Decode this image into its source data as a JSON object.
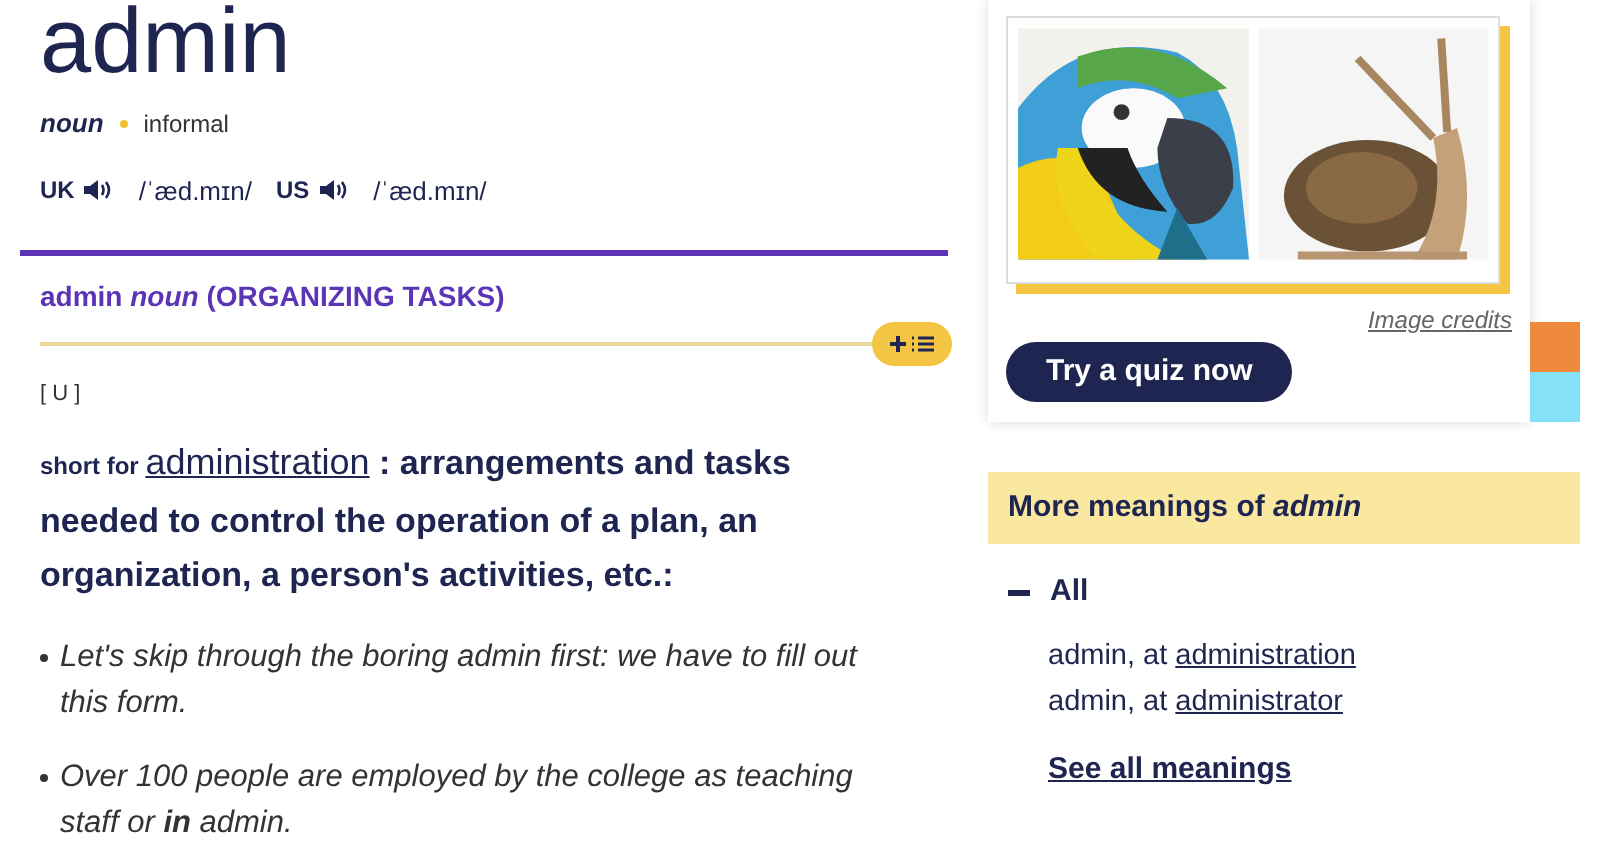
{
  "headword": "admin",
  "pos": {
    "label": "noun",
    "register": "informal"
  },
  "pronunciations": [
    {
      "region": "UK",
      "ipa": "/ˈæd.mɪn/"
    },
    {
      "region": "US",
      "ipa": "/ˈæd.mɪn/"
    }
  ],
  "sense": {
    "word": "admin",
    "pos": "noun",
    "guide": "(ORGANIZING TASKS)",
    "grammar": "[ U ]",
    "definition": {
      "prefix": "short for",
      "link": "administration",
      "text": ": arrangements and tasks needed to control the operation of a plan, an organization, a person's activities, etc.:"
    },
    "examples": [
      "Let's skip through the boring admin first: we have to fill out this form.",
      "Over 100 people are employed by the college as teaching staff or **in** admin."
    ]
  },
  "quiz_card": {
    "credits": "Image credits",
    "button": "Try a quiz now"
  },
  "more_meanings": {
    "title": "More meanings of *admin*",
    "group": {
      "label": "All",
      "expanded": true,
      "items": [
        {
          "prefix": "admin, at",
          "link": "administration"
        },
        {
          "prefix": "admin, at",
          "link": "administrator"
        }
      ]
    },
    "see_all": "See all meanings"
  }
}
